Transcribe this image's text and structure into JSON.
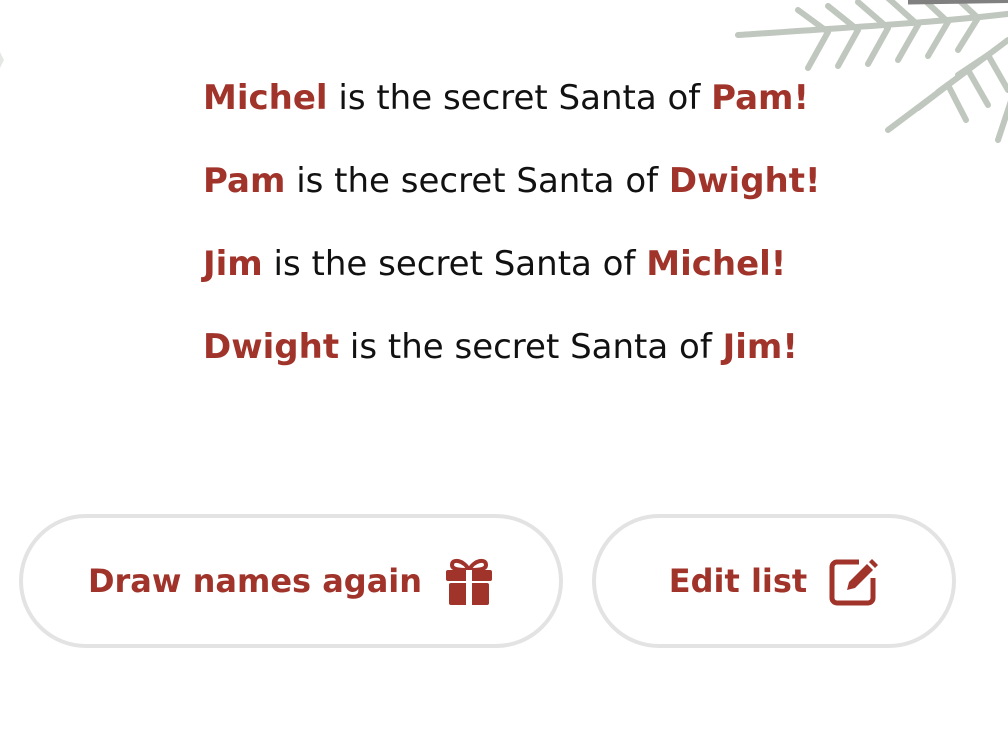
{
  "results": [
    {
      "giver": "Michel",
      "text": " is the secret Santa of ",
      "receiver": "Pam!"
    },
    {
      "giver": "Pam",
      "text": " is the secret Santa of ",
      "receiver": "Dwight!"
    },
    {
      "giver": "Jim",
      "text": " is the secret Santa of ",
      "receiver": "Michel!"
    },
    {
      "giver": "Dwight",
      "text": " is the secret Santa of ",
      "receiver": "Jim!"
    }
  ],
  "buttons": {
    "draw_again": {
      "label": "Draw names again",
      "icon": "gift-icon"
    },
    "edit_list": {
      "label": "Edit list",
      "icon": "edit-icon"
    }
  },
  "colors": {
    "accent": "#a0332a",
    "text": "#111111",
    "button_border": "#e3e3e3",
    "background": "#ffffff"
  }
}
